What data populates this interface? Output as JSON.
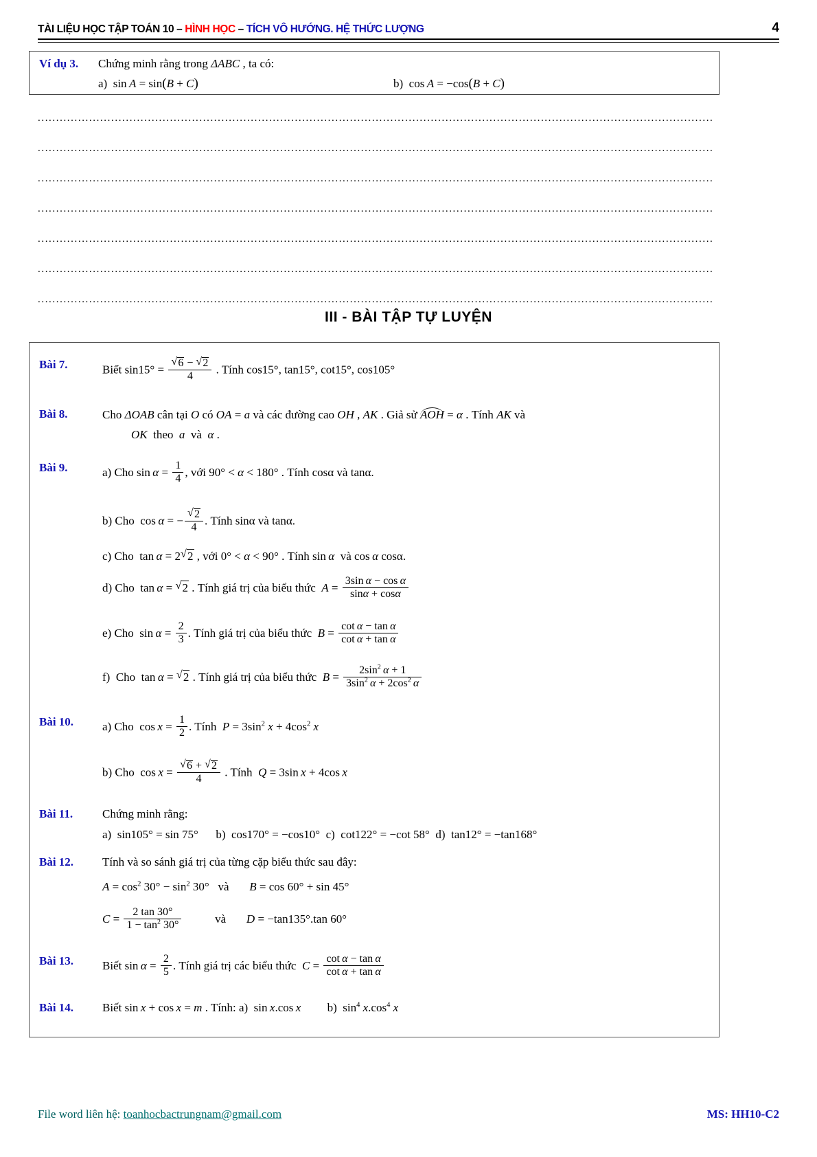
{
  "header": {
    "title_part1": "TÀI LIỆU HỌC TẬP TOÁN 10",
    "sep1": " – ",
    "title_part2": "HÌNH HỌC",
    "sep2": " – ",
    "title_part3": "TÍCH VÔ HƯỚNG. HỆ THỨC LƯỢNG",
    "page_number": "4",
    "color_black": "#000000",
    "color_red": "#ff0000",
    "color_blue": "#1414b4"
  },
  "example": {
    "label": "Ví dụ 3.",
    "text": "Chứng minh rằng trong ΔABC , ta có:",
    "item_a": "a)  sin A = sin ( B + C )",
    "item_b": "b)  cos A = – cos ( B + C )"
  },
  "answer_lines": {
    "count": 7,
    "dot_string": "........................................................................................................................................................................................"
  },
  "section": {
    "heading": "III - BÀI TẬP TỰ LUYỆN"
  },
  "exercises": [
    {
      "id": "bai-7",
      "label": "Bài 7.",
      "lines": [
        "Biết sin15° = (√6 − √2)/4 . Tính cos15° , tan15° , cot15° , cos105°"
      ]
    },
    {
      "id": "bai-8",
      "label": "Bài 8.",
      "lines": [
        "Cho ΔOAB cân tại O có OA = a và các đường cao OH , AK . Giả sử AOH = α . Tính AK và",
        "OK theo a và α ."
      ]
    },
    {
      "id": "bai-9",
      "label": "Bài 9.",
      "lines": [
        "a) Cho sin α = 1/4, với 90° < α < 180° . Tính cosα và tanα.",
        "b) Cho cos α = −√2/4 . Tính sinα và tanα.",
        "c) Cho tan α = 2√2 , với 0° < α < 90° . Tính sin α và cos α cosα.",
        "d) Cho tan α = √2 . Tính giá trị của biểu thức A = (3sin α − cos α)/(sin α + cos α)",
        "e) Cho sin α = 2/3 . Tính giá trị của biểu thức B = (cot α − tan α)/(cot α + tan α)",
        "f) Cho tan α = √2 . Tính giá trị của biểu thức B = (2sin² α + 1)/(3sin² α + 2cos² α)"
      ]
    },
    {
      "id": "bai-10",
      "label": "Bài 10.",
      "lines": [
        "a) Cho cos x = 1/2 . Tính P = 3sin² x + 4cos² x",
        "b) Cho cos x = (√6 + √2)/4 . Tính Q = 3sin x + 4cos x"
      ]
    },
    {
      "id": "bai-11",
      "label": "Bài 11.",
      "lines": [
        "Chứng minh rằng:",
        "a) sin105° = sin 75°     b) cos170° = − cos10°  c) cot122° = − cot 58°  d) tan12° = − tan168°"
      ]
    },
    {
      "id": "bai-12",
      "label": "Bài 12.",
      "lines": [
        "Tính và so sánh giá trị của từng cặp biểu thức sau đây:",
        "A = cos² 30° − sin² 30°     và     B = cos 60° + sin 45°",
        "C = 2tan30° / (1 − tan² 30°)          và     D = − tan135°. tan 60°"
      ]
    },
    {
      "id": "bai-13",
      "label": "Bài 13.",
      "lines": [
        "Biết sin α = 2/5 . Tính giá trị các biểu thức C = (cot α − tan α)/(cot α + tan α)"
      ]
    },
    {
      "id": "bai-14",
      "label": "Bài 14.",
      "lines": [
        "Biết sin x + cos x = m . Tính: a) sin x.cos x          b) sin⁴ x.cos⁴ x"
      ]
    }
  ],
  "footer": {
    "left_prefix": "File word liên hệ: ",
    "email": "toanhocbactrungnam@gmail.com",
    "right": "MS: HH10-C2",
    "left_color": "#006060",
    "right_color": "#1414b4"
  }
}
